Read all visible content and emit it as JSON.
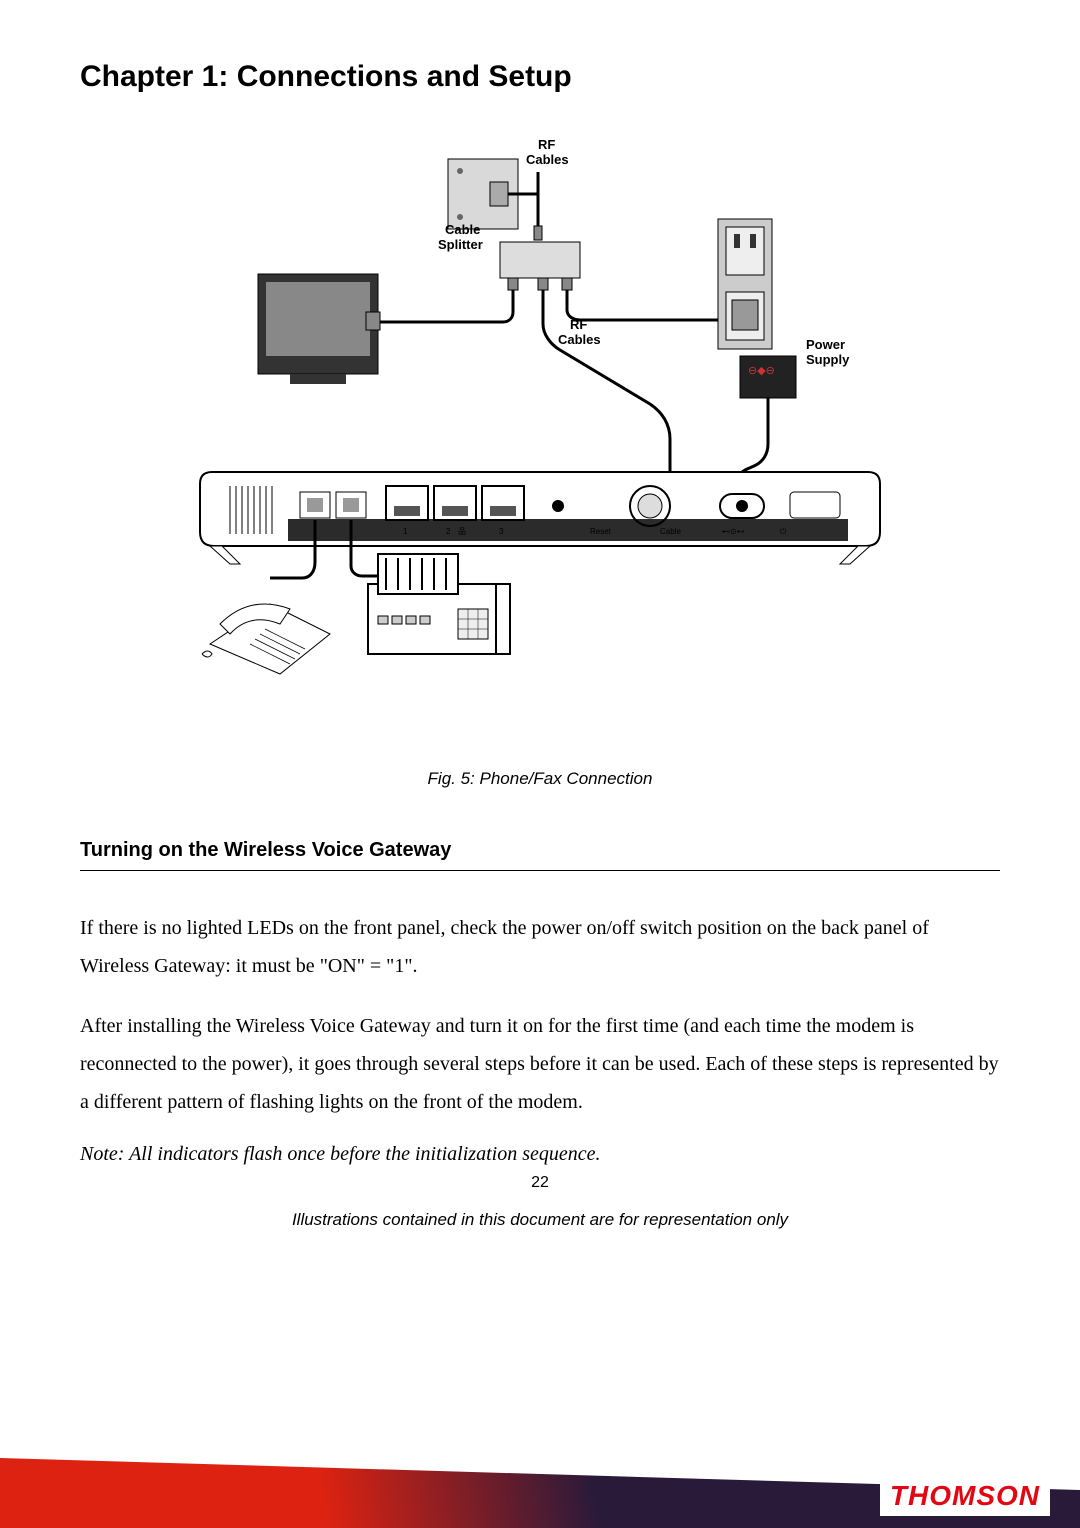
{
  "chapter_title": "Chapter 1: Connections and Setup",
  "figure": {
    "labels": {
      "rf_cables_top": "RF\nCables",
      "cable_splitter": "Cable\nSplitter",
      "rf_cables_mid": "RF\nCables",
      "power_supply": "Power\nSupply"
    },
    "device_back": {
      "port1": "1",
      "port2": "2",
      "port3": "3",
      "lan_icon": "品",
      "reset": "Reset",
      "cable": "Cable",
      "usb": "⊷",
      "pwr_icon": "⏻"
    },
    "caption": "Fig. 5: Phone/Fax Connection"
  },
  "section_title": "Turning on the Wireless Voice Gateway",
  "paragraph1": "If there is no lighted LEDs on the front panel, check the power on/off switch position on the back panel of Wireless Gateway: it must be \"ON\" = \"1\".",
  "paragraph2": "After installing the Wireless Voice Gateway and turn it on for the first time (and each time the modem is reconnected to the power), it goes through several steps before it can be used. Each of these steps is represented by a different pattern of flashing lights on the front of the modem.",
  "note": "Note: All indicators flash once before the initialization sequence.",
  "page_number": "22",
  "footer_text": "Illustrations contained in this document are for representation only",
  "brand": "THOMSON"
}
